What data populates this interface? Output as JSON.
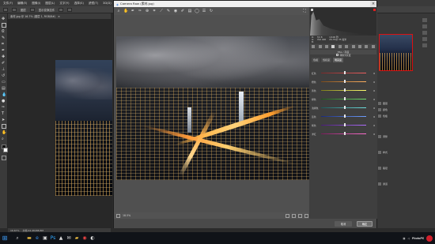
{
  "menubar": {
    "items": [
      "文件(F)",
      "编辑(E)",
      "图像(I)",
      "图层(L)",
      "文字(Y)",
      "选择(S)",
      "滤镜(T)",
      "3D(D)",
      "视图(V)",
      "窗口(W)",
      "帮助(H)"
    ]
  },
  "options_bar": {
    "label_1": "图层",
    "label_2": "显示变换控件"
  },
  "doc_tab": {
    "title": "素材.jpg @ 16.7% (图层 1, RGB/8#)"
  },
  "status_bar": {
    "zoom": "16.67%",
    "info": "文档:44.4M/88.8M"
  },
  "camera_raw": {
    "title": "Camera Raw (素材.jpg)",
    "tools": [
      "zoom-icon",
      "hand-icon",
      "white-balance-icon",
      "color-sampler-icon",
      "target-adjust-icon",
      "crop-icon",
      "straighten-icon",
      "spot-removal-icon",
      "red-eye-icon",
      "adjustment-brush-icon",
      "graduated-filter-icon",
      "radial-filter-icon",
      "preferences-icon",
      "rotate-icon"
    ],
    "readout": {
      "r": "R:",
      "g": "G:",
      "b": "B:",
      "f": "f/2.8",
      "speed": "1/100 秒",
      "iso": "ISO 400",
      "lens": "24-70@ 35 毫米"
    },
    "panel_title": "HSL / 灰度",
    "subpanel_title": "转换为灰度",
    "subtabs": [
      "色相",
      "饱和度",
      "明亮度"
    ],
    "active_subtab": "明亮度",
    "sliders": [
      {
        "label": "红色",
        "value": "0",
        "colors": [
          "#7a2a2a",
          "#f06060"
        ],
        "pos": 0.5
      },
      {
        "label": "橙色",
        "value": "0",
        "colors": [
          "#7a4a1a",
          "#ffb060"
        ],
        "pos": 0.5
      },
      {
        "label": "黄色",
        "value": "0",
        "colors": [
          "#7a7a1a",
          "#ffff70"
        ],
        "pos": 0.5
      },
      {
        "label": "绿色",
        "value": "0",
        "colors": [
          "#1a5a1a",
          "#70e070"
        ],
        "pos": 0.5
      },
      {
        "label": "浅绿色",
        "value": "0",
        "colors": [
          "#1a5a5a",
          "#70e0e0"
        ],
        "pos": 0.5
      },
      {
        "label": "蓝色",
        "value": "0",
        "colors": [
          "#1a2a7a",
          "#70a0ff"
        ],
        "pos": 0.5
      },
      {
        "label": "紫色",
        "value": "0",
        "colors": [
          "#4a1a7a",
          "#b070ff"
        ],
        "pos": 0.5
      },
      {
        "label": "洋红",
        "value": "0",
        "colors": [
          "#7a1a5a",
          "#ff70d0"
        ],
        "pos": 0.5
      }
    ],
    "zoom": "18.5%",
    "cancel_label": "取消",
    "ok_label": "确定"
  },
  "ps_right": {
    "rows": [
      "图层",
      "颜色",
      "色板",
      "调整",
      "样式",
      "路径",
      "通道"
    ]
  },
  "taskbar": {
    "start_icon": "windows-icon",
    "apps": [
      "file-explorer-icon",
      "edge-icon",
      "store-icon",
      "photoshop-icon",
      "photos-icon",
      "mail-icon",
      "folder-icon",
      "chrome-icon",
      "qq-icon"
    ],
    "watermark": "PhotoPS"
  }
}
